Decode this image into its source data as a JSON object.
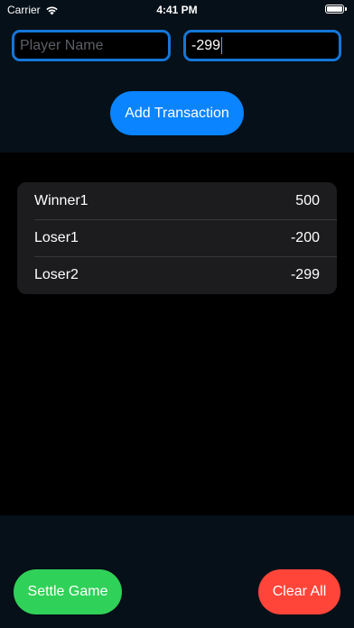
{
  "status_bar": {
    "carrier": "Carrier",
    "time": "4:41 PM",
    "icons": [
      "wifi-icon",
      "battery-icon"
    ]
  },
  "form": {
    "name_placeholder": "Player Name",
    "name_value": "",
    "amount_value": "-299",
    "add_label": "Add Transaction"
  },
  "transactions": [
    {
      "player": "Winner1",
      "amount": "500"
    },
    {
      "player": "Loser1",
      "amount": "-200"
    },
    {
      "player": "Loser2",
      "amount": "-299"
    }
  ],
  "footer": {
    "settle_label": "Settle Game",
    "clear_label": "Clear All"
  },
  "colors": {
    "accent": "#0a84ff",
    "field_border": "#1476d8",
    "settle": "#30d158",
    "clear": "#ff453a",
    "panel": "#051018",
    "list_bg": "#1c1c1e"
  }
}
